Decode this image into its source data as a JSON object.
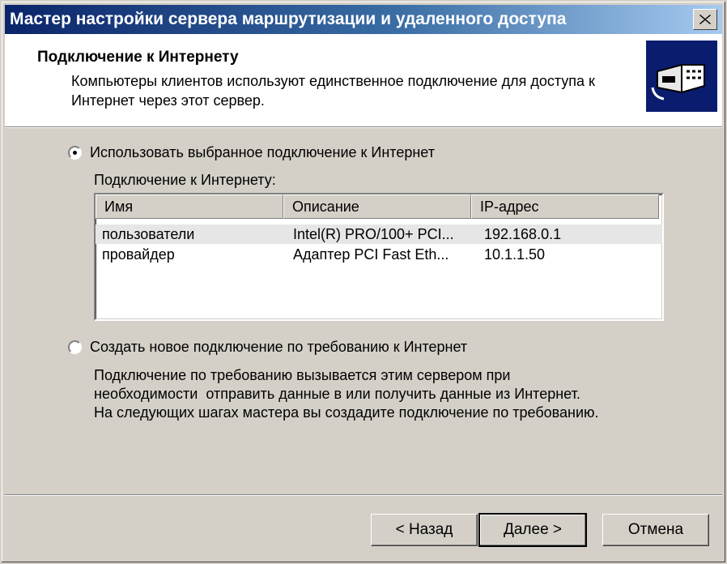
{
  "window": {
    "title": "Мастер настройки сервера маршрутизации и удаленного доступа"
  },
  "header": {
    "title": "Подключение к Интернету",
    "description": "Компьютеры клиентов используют единственное подключение для доступа к Интернет через этот сервер."
  },
  "options": {
    "use_existing_label": "Использовать выбранное подключение к Интернет",
    "use_existing_selected": true,
    "create_new_label": "Создать новое подключение по требованию к Интернет",
    "create_new_selected": false
  },
  "connections": {
    "label": "Подключение к Интернету:",
    "columns": [
      "Имя",
      "Описание",
      "IP-адрес"
    ],
    "rows": [
      {
        "name": "пользователи",
        "description": "Intel(R) PRO/100+ PCI...",
        "ip": "192.168.0.1",
        "selected": true
      },
      {
        "name": "провайдер",
        "description": "Адаптер PCI Fast Eth...",
        "ip": "10.1.1.50",
        "selected": false
      }
    ]
  },
  "demand_dial_description": {
    "line1": "Подключение по требованию вызывается этим сервером при",
    "line2": "необходимости  отправить данные в или получить данные из Интернет.",
    "line3": "На следующих шагах мастера вы создадите подключение по требованию."
  },
  "buttons": {
    "back": "< Назад",
    "next": "Далее >",
    "cancel": "Отмена"
  },
  "icons": {
    "close": "close-icon",
    "wizard": "network-connection-icon"
  },
  "colors": {
    "titlebar_start": "#0a246a",
    "titlebar_end": "#a6caf0",
    "dialog_bg": "#d4d0c8",
    "wizard_icon_bg": "#0a1c6e"
  }
}
